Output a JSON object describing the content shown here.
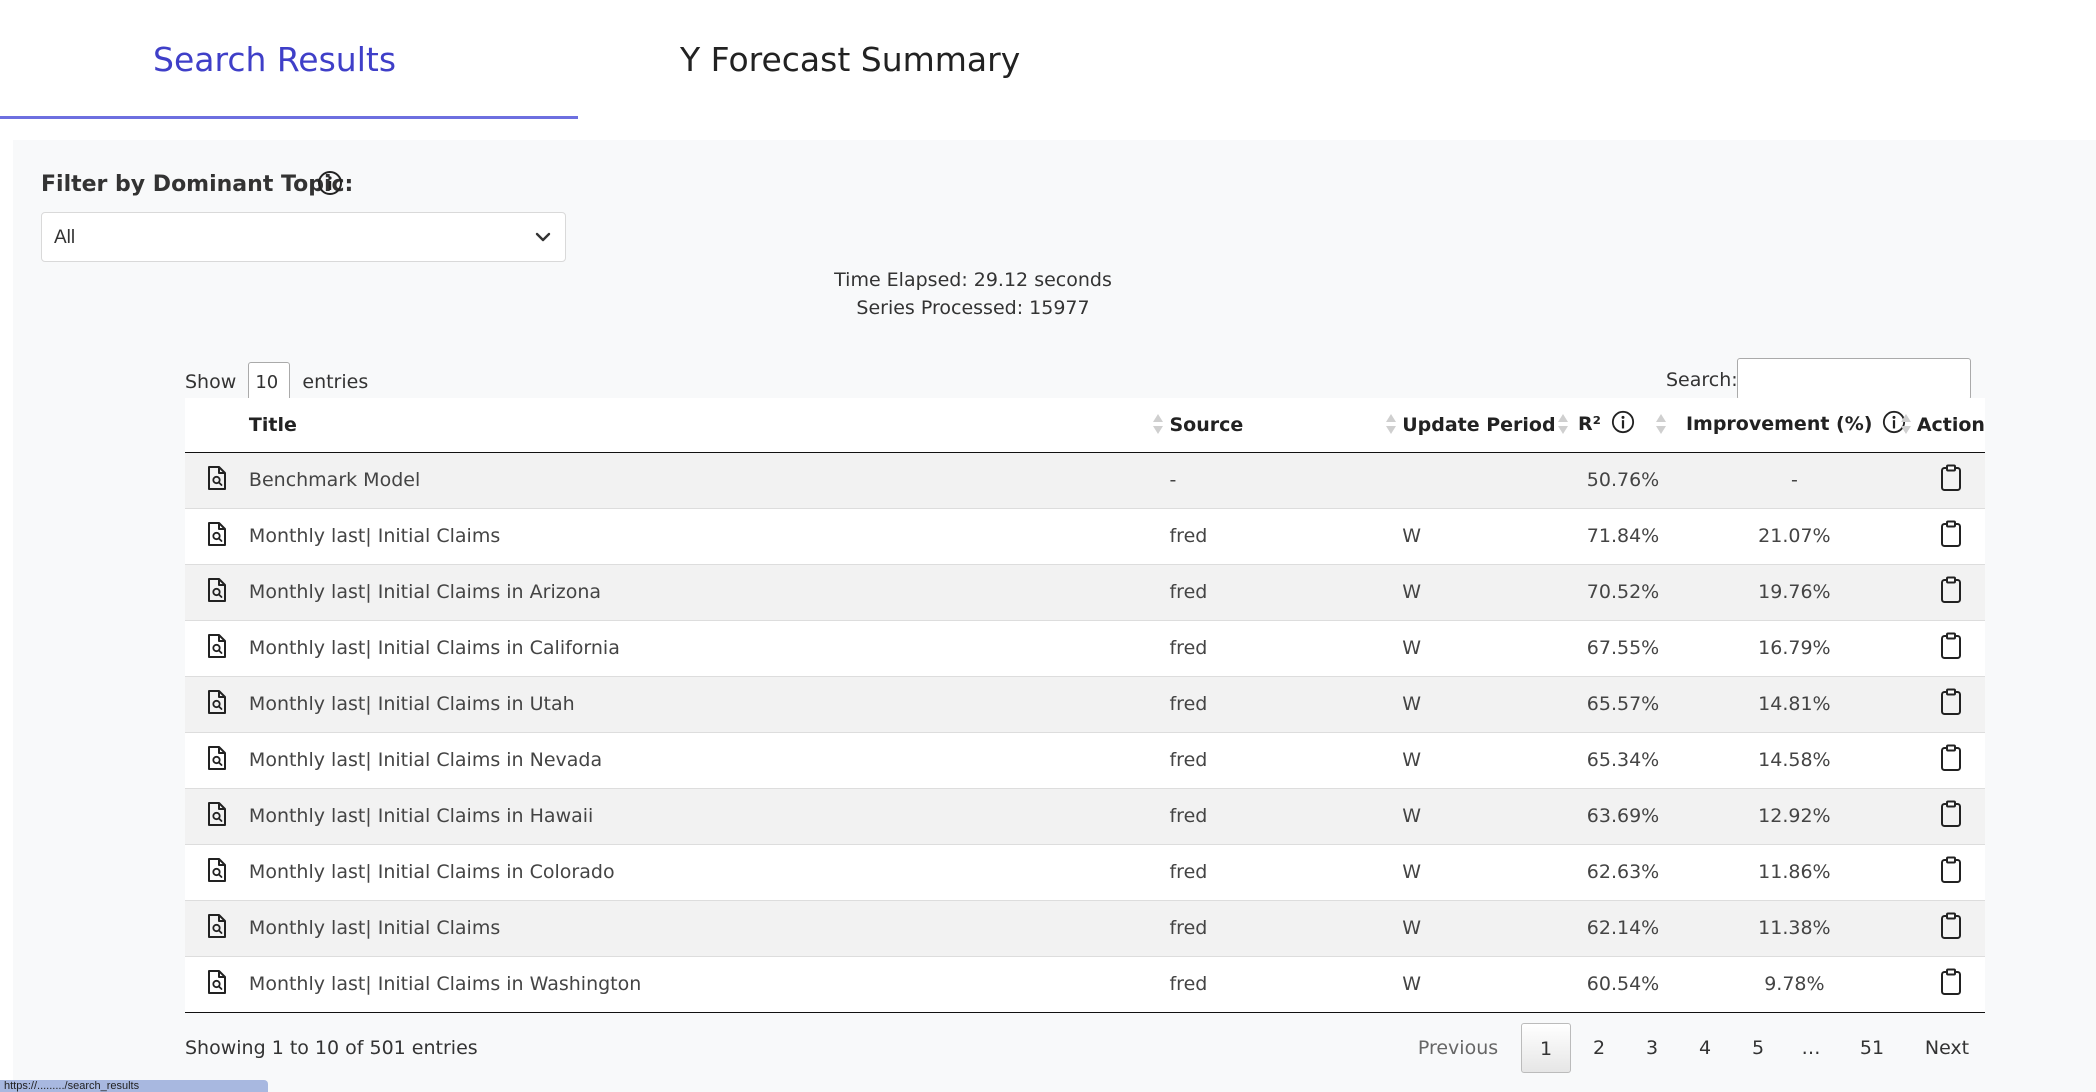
{
  "tabs": [
    {
      "label": "Search Results",
      "active": true
    },
    {
      "label": "Y Forecast Summary",
      "active": false
    }
  ],
  "filter": {
    "label": "Filter by Dominant Topic:",
    "selected": "All"
  },
  "stats": {
    "time_elapsed": "Time Elapsed: 29.12 seconds",
    "series_processed": "Series Processed: 15977"
  },
  "length_control": {
    "prefix": "Show",
    "value": "10",
    "suffix": "entries"
  },
  "search": {
    "label": "Search:",
    "value": ""
  },
  "table": {
    "headers": {
      "title": "Title",
      "source": "Source",
      "update_period": "Update Period",
      "r2": "R²",
      "improvement": "Improvement (%)",
      "action": "Action"
    },
    "rows": [
      {
        "title": "Benchmark Model",
        "source": "-",
        "period": "",
        "r2": "50.76%",
        "improvement": "-"
      },
      {
        "title": "Monthly last| Initial Claims",
        "source": "fred",
        "period": "W",
        "r2": "71.84%",
        "improvement": "21.07%"
      },
      {
        "title": "Monthly last| Initial Claims in Arizona",
        "source": "fred",
        "period": "W",
        "r2": "70.52%",
        "improvement": "19.76%"
      },
      {
        "title": "Monthly last| Initial Claims in California",
        "source": "fred",
        "period": "W",
        "r2": "67.55%",
        "improvement": "16.79%"
      },
      {
        "title": "Monthly last| Initial Claims in Utah",
        "source": "fred",
        "period": "W",
        "r2": "65.57%",
        "improvement": "14.81%"
      },
      {
        "title": "Monthly last| Initial Claims in Nevada",
        "source": "fred",
        "period": "W",
        "r2": "65.34%",
        "improvement": "14.58%"
      },
      {
        "title": "Monthly last| Initial Claims in Hawaii",
        "source": "fred",
        "period": "W",
        "r2": "63.69%",
        "improvement": "12.92%"
      },
      {
        "title": "Monthly last| Initial Claims in Colorado",
        "source": "fred",
        "period": "W",
        "r2": "62.63%",
        "improvement": "11.86%"
      },
      {
        "title": "Monthly last| Initial Claims",
        "source": "fred",
        "period": "W",
        "r2": "62.14%",
        "improvement": "11.38%"
      },
      {
        "title": "Monthly last| Initial Claims in Washington",
        "source": "fred",
        "period": "W",
        "r2": "60.54%",
        "improvement": "9.78%"
      }
    ]
  },
  "footer": {
    "info": "Showing 1 to 10 of 501 entries"
  },
  "pagination": {
    "previous": "Previous",
    "pages": [
      "1",
      "2",
      "3",
      "4",
      "5",
      "…",
      "51"
    ],
    "current": "1",
    "next": "Next"
  },
  "status_bar": {
    "text": "https://........./search_results"
  },
  "colors": {
    "accent": "#3f3fc8",
    "underline": "#6d6fe0",
    "panel_bg": "#f8f9fa"
  }
}
